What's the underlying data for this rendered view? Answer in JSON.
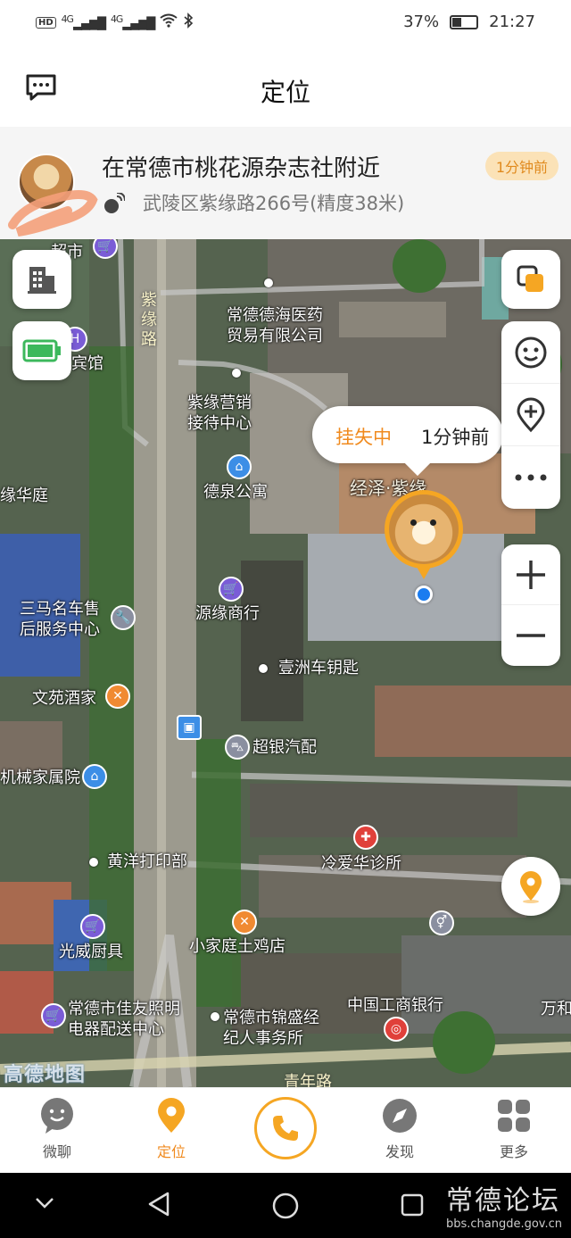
{
  "status_bar": {
    "signal_1": "4G",
    "signal_2": "4G",
    "battery_percent": "37%",
    "time": "21:27"
  },
  "header": {
    "title": "定位"
  },
  "location": {
    "main": "在常德市桃花源杂志社附近",
    "time_badge": "1分钟前",
    "detail": "武陵区紫缘路266号(精度38米)"
  },
  "map": {
    "pois": [
      {
        "key": "bank_top",
        "label": "...超市"
      },
      {
        "key": "hospital_co",
        "label": "常德德海医药\n贸易有限公司"
      },
      {
        "key": "hotel",
        "label": "宾馆"
      },
      {
        "key": "ziyuan_sales",
        "label": "紫缘营销\n接待中心"
      },
      {
        "key": "dequan",
        "label": "德泉公寓"
      },
      {
        "key": "yuanhua",
        "label": "缘华庭"
      },
      {
        "key": "jingze",
        "label": "经泽·紫缘"
      },
      {
        "key": "sanma",
        "label": "三马名车售\n后服务中心"
      },
      {
        "key": "yuanyuan",
        "label": "源缘商行"
      },
      {
        "key": "yizhou",
        "label": "壹洲车钥匙"
      },
      {
        "key": "wenyuan",
        "label": "文苑酒家"
      },
      {
        "key": "chaoyin",
        "label": "超银汽配"
      },
      {
        "key": "jixie",
        "label": "机械家属院"
      },
      {
        "key": "huangyang",
        "label": "黄洋打印部"
      },
      {
        "key": "lengai",
        "label": "冷爱华诊所"
      },
      {
        "key": "guangwei",
        "label": "光威厨具"
      },
      {
        "key": "xiaojiating",
        "label": "小家庭土鸡店"
      },
      {
        "key": "jiayou",
        "label": "常德市佳友照明\n电器配送中心"
      },
      {
        "key": "jinsheng",
        "label": "常德市锦盛经\n纪人事务所"
      },
      {
        "key": "icbc",
        "label": "中国工商银行"
      },
      {
        "key": "wanhe",
        "label": "万和"
      }
    ],
    "road_ziyuan": "紫缘路",
    "road_qingnian": "青年路",
    "watermark": "高德地图",
    "bubble_status": "挂失中",
    "bubble_time": "1分钟前"
  },
  "tabs": [
    {
      "label": "微聊",
      "icon": "chat-bubble-icon",
      "active": false
    },
    {
      "label": "定位",
      "icon": "location-pin-icon",
      "active": true
    },
    {
      "label": "发现",
      "icon": "compass-icon",
      "active": false
    },
    {
      "label": "更多",
      "icon": "grid-icon",
      "active": false
    }
  ],
  "forum": {
    "name": "常德论坛",
    "url": "bbs.changde.gov.cn"
  },
  "colors": {
    "accent": "#f5a623",
    "accent_text": "#f08a1e",
    "badge_bg": "#fbe2b7",
    "blue_dot": "#1a7cf0"
  }
}
